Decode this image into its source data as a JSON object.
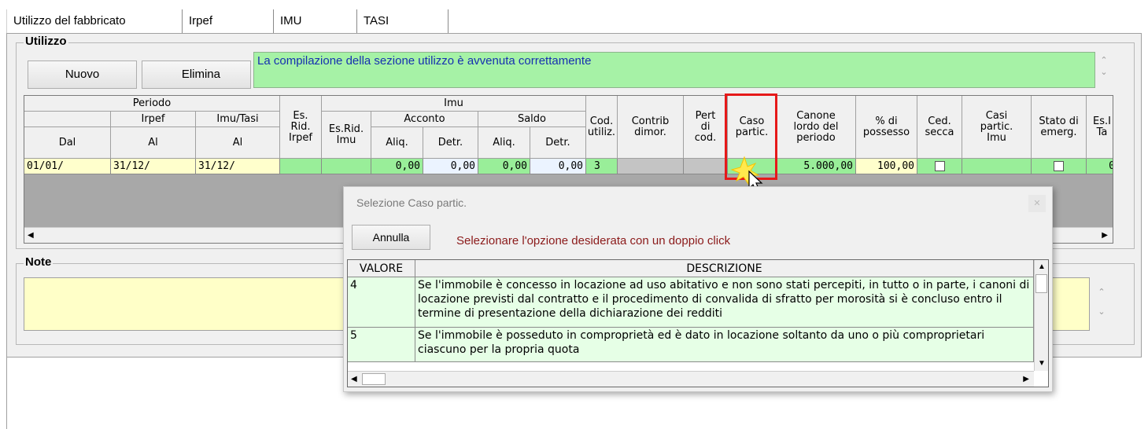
{
  "tabs": [
    "Utilizzo del fabbricato",
    "Irpef",
    "IMU",
    "TASI"
  ],
  "utilizzo": {
    "title": "Utilizzo",
    "nuovo_label": "Nuovo",
    "elimina_label": "Elimina",
    "message": "La compilazione della sezione utilizzo è avvenuta correttamente"
  },
  "grid": {
    "headers": {
      "periodo": "Periodo",
      "irpef": "Irpef",
      "imu_tasi": "Imu/Tasi",
      "dal": "Dal",
      "al1": "Al",
      "al2": "Al",
      "es_rid_irpef": "Es.\nRid.\nIrpef",
      "imu": "Imu",
      "es_rid_imu": "Es.Rid.\nImu",
      "acconto": "Acconto",
      "saldo": "Saldo",
      "aliq1": "Aliq.",
      "detr1": "Detr.",
      "aliq2": "Aliq.",
      "detr2": "Detr.",
      "cod_utiliz": "Cod.\nutiliz.",
      "contrib_dimor": "Contrib\ndimor.",
      "pert_di_cod": "Pert\ndi\ncod.",
      "caso_partic": "Caso\npartic.",
      "canone": "Canone\nlordo del\nperiodo",
      "possesso": "% di\npossesso",
      "ced_secca": "Ced.\nsecca",
      "casi_partic_imu": "Casi\npartic.\nImu",
      "stato_emerg": "Stato di\nemerg.",
      "es_ta": "Es.I\nTa"
    },
    "row": {
      "dal": "01/01/",
      "al_irpef": "31/12/",
      "al_imu": "31/12/",
      "aliq_acconto": "0,00",
      "detr_acconto": "0,00",
      "aliq_saldo": "0,00",
      "detr_saldo": "0,00",
      "cod_utiliz": "3",
      "canone": "5.000,00",
      "possesso": "100,00",
      "last": "0"
    }
  },
  "note": {
    "title": "Note"
  },
  "dialog": {
    "title": "Selezione Caso partic.",
    "close": "✕",
    "annulla_label": "Annulla",
    "hint": "Selezionare l'opzione desiderata con un doppio click",
    "col_valore": "VALORE",
    "col_descrizione": "DESCRIZIONE",
    "rows": [
      {
        "valore": "4",
        "descrizione": "Se l'immobile è concesso in locazione ad uso abitativo e non sono stati percepiti, in tutto o in parte, i canoni di locazione previsti dal contratto e il procedimento di convalida di sfratto per morosità si è concluso entro il termine di presentazione della dichiarazione dei redditi"
      },
      {
        "valore": "5",
        "descrizione": "Se l'immobile è posseduto in comproprietà ed è dato in locazione soltanto da uno o più comproprietari ciascuno per la propria quota"
      }
    ]
  }
}
